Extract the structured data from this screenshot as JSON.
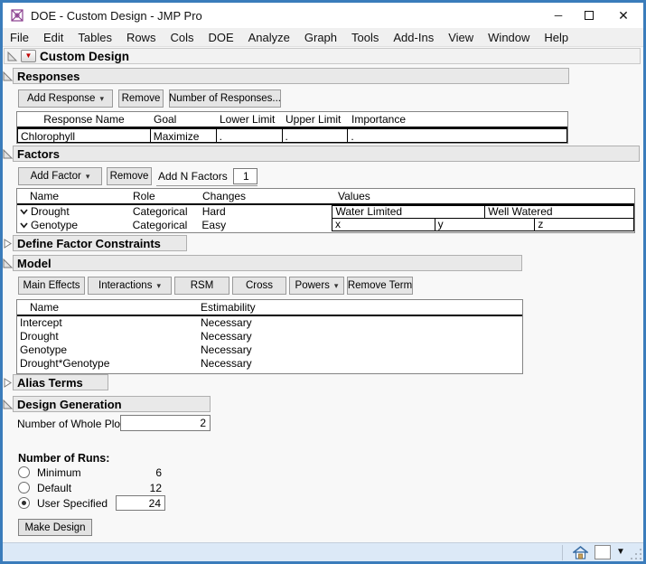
{
  "window": {
    "title": "DOE - Custom Design - JMP Pro"
  },
  "icons": {
    "red_triangle": "▼",
    "dropdown_arrow": "▾",
    "caret_down": "▼",
    "minimize": "─",
    "close": "✕"
  },
  "menu": {
    "items": [
      "File",
      "Edit",
      "Tables",
      "Rows",
      "Cols",
      "DOE",
      "Analyze",
      "Graph",
      "Tools",
      "Add-Ins",
      "View",
      "Window",
      "Help"
    ]
  },
  "outline": {
    "title": "Custom Design"
  },
  "responses": {
    "header": "Responses",
    "add_button": "Add Response",
    "remove_button": "Remove",
    "number_button": "Number of Responses...",
    "columns": [
      "Response Name",
      "Goal",
      "Lower Limit",
      "Upper Limit",
      "Importance"
    ],
    "row": {
      "name": "Chlorophyll",
      "goal": "Maximize",
      "lower": ".",
      "upper": ".",
      "importance": "."
    }
  },
  "factors": {
    "header": "Factors",
    "add_button": "Add Factor",
    "remove_button": "Remove",
    "add_n_label": "Add N Factors",
    "add_n_value": "1",
    "columns": [
      "Name",
      "Role",
      "Changes",
      "Values"
    ],
    "rows": [
      {
        "name": "Drought",
        "role": "Categorical",
        "changes": "Hard",
        "values": [
          "Water Limited",
          "Well Watered"
        ]
      },
      {
        "name": "Genotype",
        "role": "Categorical",
        "changes": "Easy",
        "values": [
          "x",
          "y",
          "z"
        ]
      }
    ]
  },
  "constraints": {
    "header": "Define Factor Constraints"
  },
  "model": {
    "header": "Model",
    "buttons": {
      "main_effects": "Main Effects",
      "interactions": "Interactions",
      "rsm": "RSM",
      "cross": "Cross",
      "powers": "Powers",
      "remove_term": "Remove Term"
    },
    "columns": [
      "Name",
      "Estimability"
    ],
    "rows": [
      {
        "name": "Intercept",
        "estimability": "Necessary"
      },
      {
        "name": "Drought",
        "estimability": "Necessary"
      },
      {
        "name": "Genotype",
        "estimability": "Necessary"
      },
      {
        "name": "Drought*Genotype",
        "estimability": "Necessary"
      }
    ]
  },
  "alias": {
    "header": "Alias Terms"
  },
  "design": {
    "header": "Design Generation",
    "whole_plots_label": "Number of Whole Plots",
    "whole_plots_value": "2",
    "runs_title": "Number of Runs:",
    "minimum_label": "Minimum",
    "minimum_value": "6",
    "default_label": "Default",
    "default_value": "12",
    "user_label": "User Specified",
    "user_value": "24",
    "make_design": "Make Design"
  },
  "colors": {
    "window_border": "#3a7cbb",
    "accent_red": "#c00000",
    "bar_bg": "#e9e9e9",
    "status_bg": "#dce9f7"
  }
}
